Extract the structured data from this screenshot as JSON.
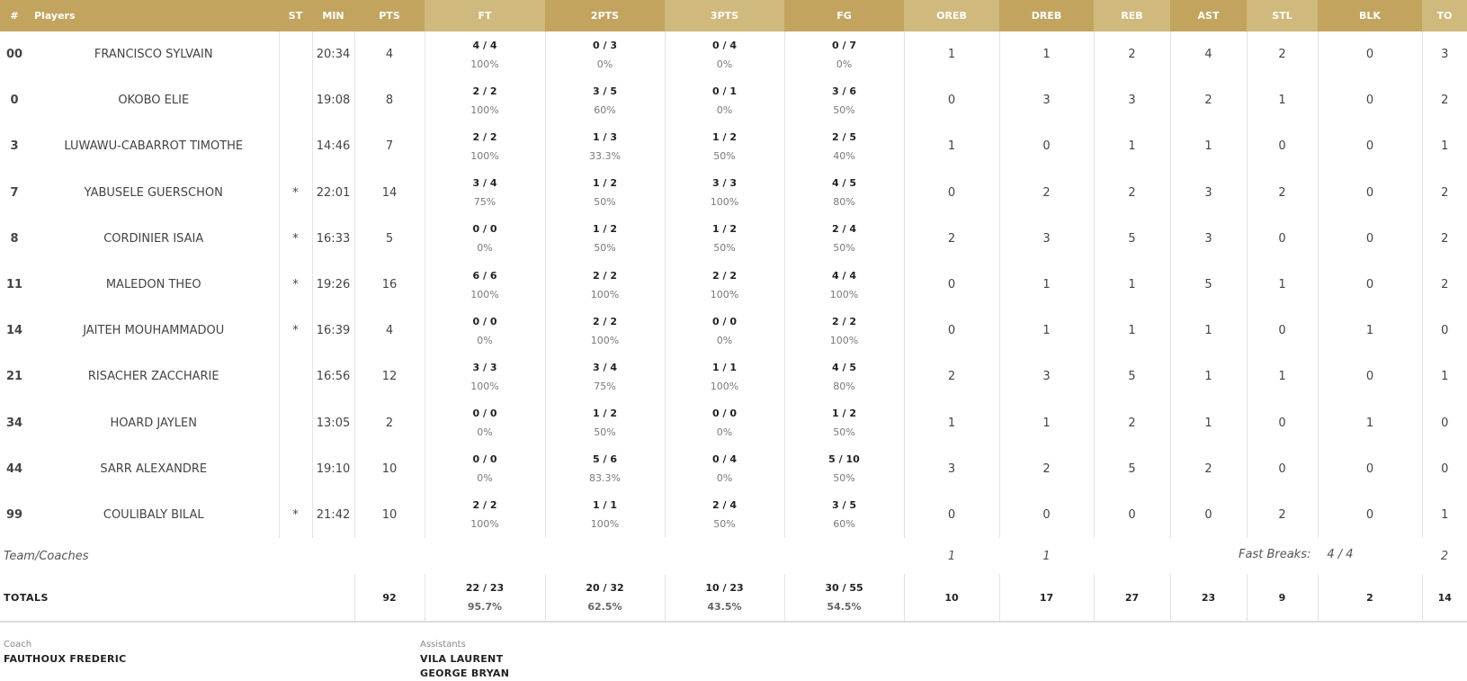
{
  "headers": {
    "num": "#",
    "players": "Players",
    "st": "ST",
    "min": "MIN",
    "pts": "PTS",
    "ft": "FT",
    "two": "2PTS",
    "three": "3PTS",
    "fg": "FG",
    "oreb": "OREB",
    "dreb": "DREB",
    "reb": "REB",
    "ast": "AST",
    "stl": "STL",
    "blk": "BLK",
    "to": "TO"
  },
  "colors": {
    "header_dark": "#c2a45f",
    "header_light": "#d0b97c"
  },
  "players": [
    {
      "num": "00",
      "name": "FRANCISCO SYLVAIN",
      "st": "",
      "min": "20:34",
      "pts": "4",
      "ft": "4 / 4",
      "ft_pct": "100%",
      "two": "0 / 3",
      "two_pct": "0%",
      "three": "0 / 4",
      "three_pct": "0%",
      "fg": "0 / 7",
      "fg_pct": "0%",
      "oreb": "1",
      "dreb": "1",
      "reb": "2",
      "ast": "4",
      "stl": "2",
      "blk": "0",
      "to": "3"
    },
    {
      "num": "0",
      "name": "OKOBO ELIE",
      "st": "",
      "min": "19:08",
      "pts": "8",
      "ft": "2 / 2",
      "ft_pct": "100%",
      "two": "3 / 5",
      "two_pct": "60%",
      "three": "0 / 1",
      "three_pct": "0%",
      "fg": "3 / 6",
      "fg_pct": "50%",
      "oreb": "0",
      "dreb": "3",
      "reb": "3",
      "ast": "2",
      "stl": "1",
      "blk": "0",
      "to": "2"
    },
    {
      "num": "3",
      "name": "LUWAWU-CABARROT TIMOTHE",
      "st": "",
      "min": "14:46",
      "pts": "7",
      "ft": "2 / 2",
      "ft_pct": "100%",
      "two": "1 / 3",
      "two_pct": "33.3%",
      "three": "1 / 2",
      "three_pct": "50%",
      "fg": "2 / 5",
      "fg_pct": "40%",
      "oreb": "1",
      "dreb": "0",
      "reb": "1",
      "ast": "1",
      "stl": "0",
      "blk": "0",
      "to": "1"
    },
    {
      "num": "7",
      "name": "YABUSELE GUERSCHON",
      "st": "*",
      "min": "22:01",
      "pts": "14",
      "ft": "3 / 4",
      "ft_pct": "75%",
      "two": "1 / 2",
      "two_pct": "50%",
      "three": "3 / 3",
      "three_pct": "100%",
      "fg": "4 / 5",
      "fg_pct": "80%",
      "oreb": "0",
      "dreb": "2",
      "reb": "2",
      "ast": "3",
      "stl": "2",
      "blk": "0",
      "to": "2"
    },
    {
      "num": "8",
      "name": "CORDINIER ISAIA",
      "st": "*",
      "min": "16:33",
      "pts": "5",
      "ft": "0 / 0",
      "ft_pct": "0%",
      "two": "1 / 2",
      "two_pct": "50%",
      "three": "1 / 2",
      "three_pct": "50%",
      "fg": "2 / 4",
      "fg_pct": "50%",
      "oreb": "2",
      "dreb": "3",
      "reb": "5",
      "ast": "3",
      "stl": "0",
      "blk": "0",
      "to": "2"
    },
    {
      "num": "11",
      "name": "MALEDON THEO",
      "st": "*",
      "min": "19:26",
      "pts": "16",
      "ft": "6 / 6",
      "ft_pct": "100%",
      "two": "2 / 2",
      "two_pct": "100%",
      "three": "2 / 2",
      "three_pct": "100%",
      "fg": "4 / 4",
      "fg_pct": "100%",
      "oreb": "0",
      "dreb": "1",
      "reb": "1",
      "ast": "5",
      "stl": "1",
      "blk": "0",
      "to": "2"
    },
    {
      "num": "14",
      "name": "JAITEH MOUHAMMADOU",
      "st": "*",
      "min": "16:39",
      "pts": "4",
      "ft": "0 / 0",
      "ft_pct": "0%",
      "two": "2 / 2",
      "two_pct": "100%",
      "three": "0 / 0",
      "three_pct": "0%",
      "fg": "2 / 2",
      "fg_pct": "100%",
      "oreb": "0",
      "dreb": "1",
      "reb": "1",
      "ast": "1",
      "stl": "0",
      "blk": "1",
      "to": "0"
    },
    {
      "num": "21",
      "name": "RISACHER ZACCHARIE",
      "st": "",
      "min": "16:56",
      "pts": "12",
      "ft": "3 / 3",
      "ft_pct": "100%",
      "two": "3 / 4",
      "two_pct": "75%",
      "three": "1 / 1",
      "three_pct": "100%",
      "fg": "4 / 5",
      "fg_pct": "80%",
      "oreb": "2",
      "dreb": "3",
      "reb": "5",
      "ast": "1",
      "stl": "1",
      "blk": "0",
      "to": "1"
    },
    {
      "num": "34",
      "name": "HOARD JAYLEN",
      "st": "",
      "min": "13:05",
      "pts": "2",
      "ft": "0 / 0",
      "ft_pct": "0%",
      "two": "1 / 2",
      "two_pct": "50%",
      "three": "0 / 0",
      "three_pct": "0%",
      "fg": "1 / 2",
      "fg_pct": "50%",
      "oreb": "1",
      "dreb": "1",
      "reb": "2",
      "ast": "1",
      "stl": "0",
      "blk": "1",
      "to": "0"
    },
    {
      "num": "44",
      "name": "SARR ALEXANDRE",
      "st": "",
      "min": "19:10",
      "pts": "10",
      "ft": "0 / 0",
      "ft_pct": "0%",
      "two": "5 / 6",
      "two_pct": "83.3%",
      "three": "0 / 4",
      "three_pct": "0%",
      "fg": "5 / 10",
      "fg_pct": "50%",
      "oreb": "3",
      "dreb": "2",
      "reb": "5",
      "ast": "2",
      "stl": "0",
      "blk": "0",
      "to": "0"
    },
    {
      "num": "99",
      "name": "COULIBALY BILAL",
      "st": "*",
      "min": "21:42",
      "pts": "10",
      "ft": "2 / 2",
      "ft_pct": "100%",
      "two": "1 / 1",
      "two_pct": "100%",
      "three": "2 / 4",
      "three_pct": "50%",
      "fg": "3 / 5",
      "fg_pct": "60%",
      "oreb": "0",
      "dreb": "0",
      "reb": "0",
      "ast": "0",
      "stl": "2",
      "blk": "0",
      "to": "1"
    }
  ],
  "team": {
    "label": "Team/Coaches",
    "oreb": "1",
    "dreb": "1",
    "to": "2",
    "fast_breaks_label": "Fast Breaks:",
    "fast_breaks_value": "4 / 4"
  },
  "totals": {
    "label": "TOTALS",
    "pts": "92",
    "ft": "22 / 23",
    "ft_pct": "95.7%",
    "two": "20 / 32",
    "two_pct": "62.5%",
    "three": "10 / 23",
    "three_pct": "43.5%",
    "fg": "30 / 55",
    "fg_pct": "54.5%",
    "oreb": "10",
    "dreb": "17",
    "reb": "27",
    "ast": "23",
    "stl": "9",
    "blk": "2",
    "to": "14"
  },
  "staff": {
    "coach_label": "Coach",
    "coach": "FAUTHOUX FREDERIC",
    "assistants_label": "Assistants",
    "assistants": [
      "VILA LAURENT",
      "GEORGE BRYAN"
    ]
  }
}
